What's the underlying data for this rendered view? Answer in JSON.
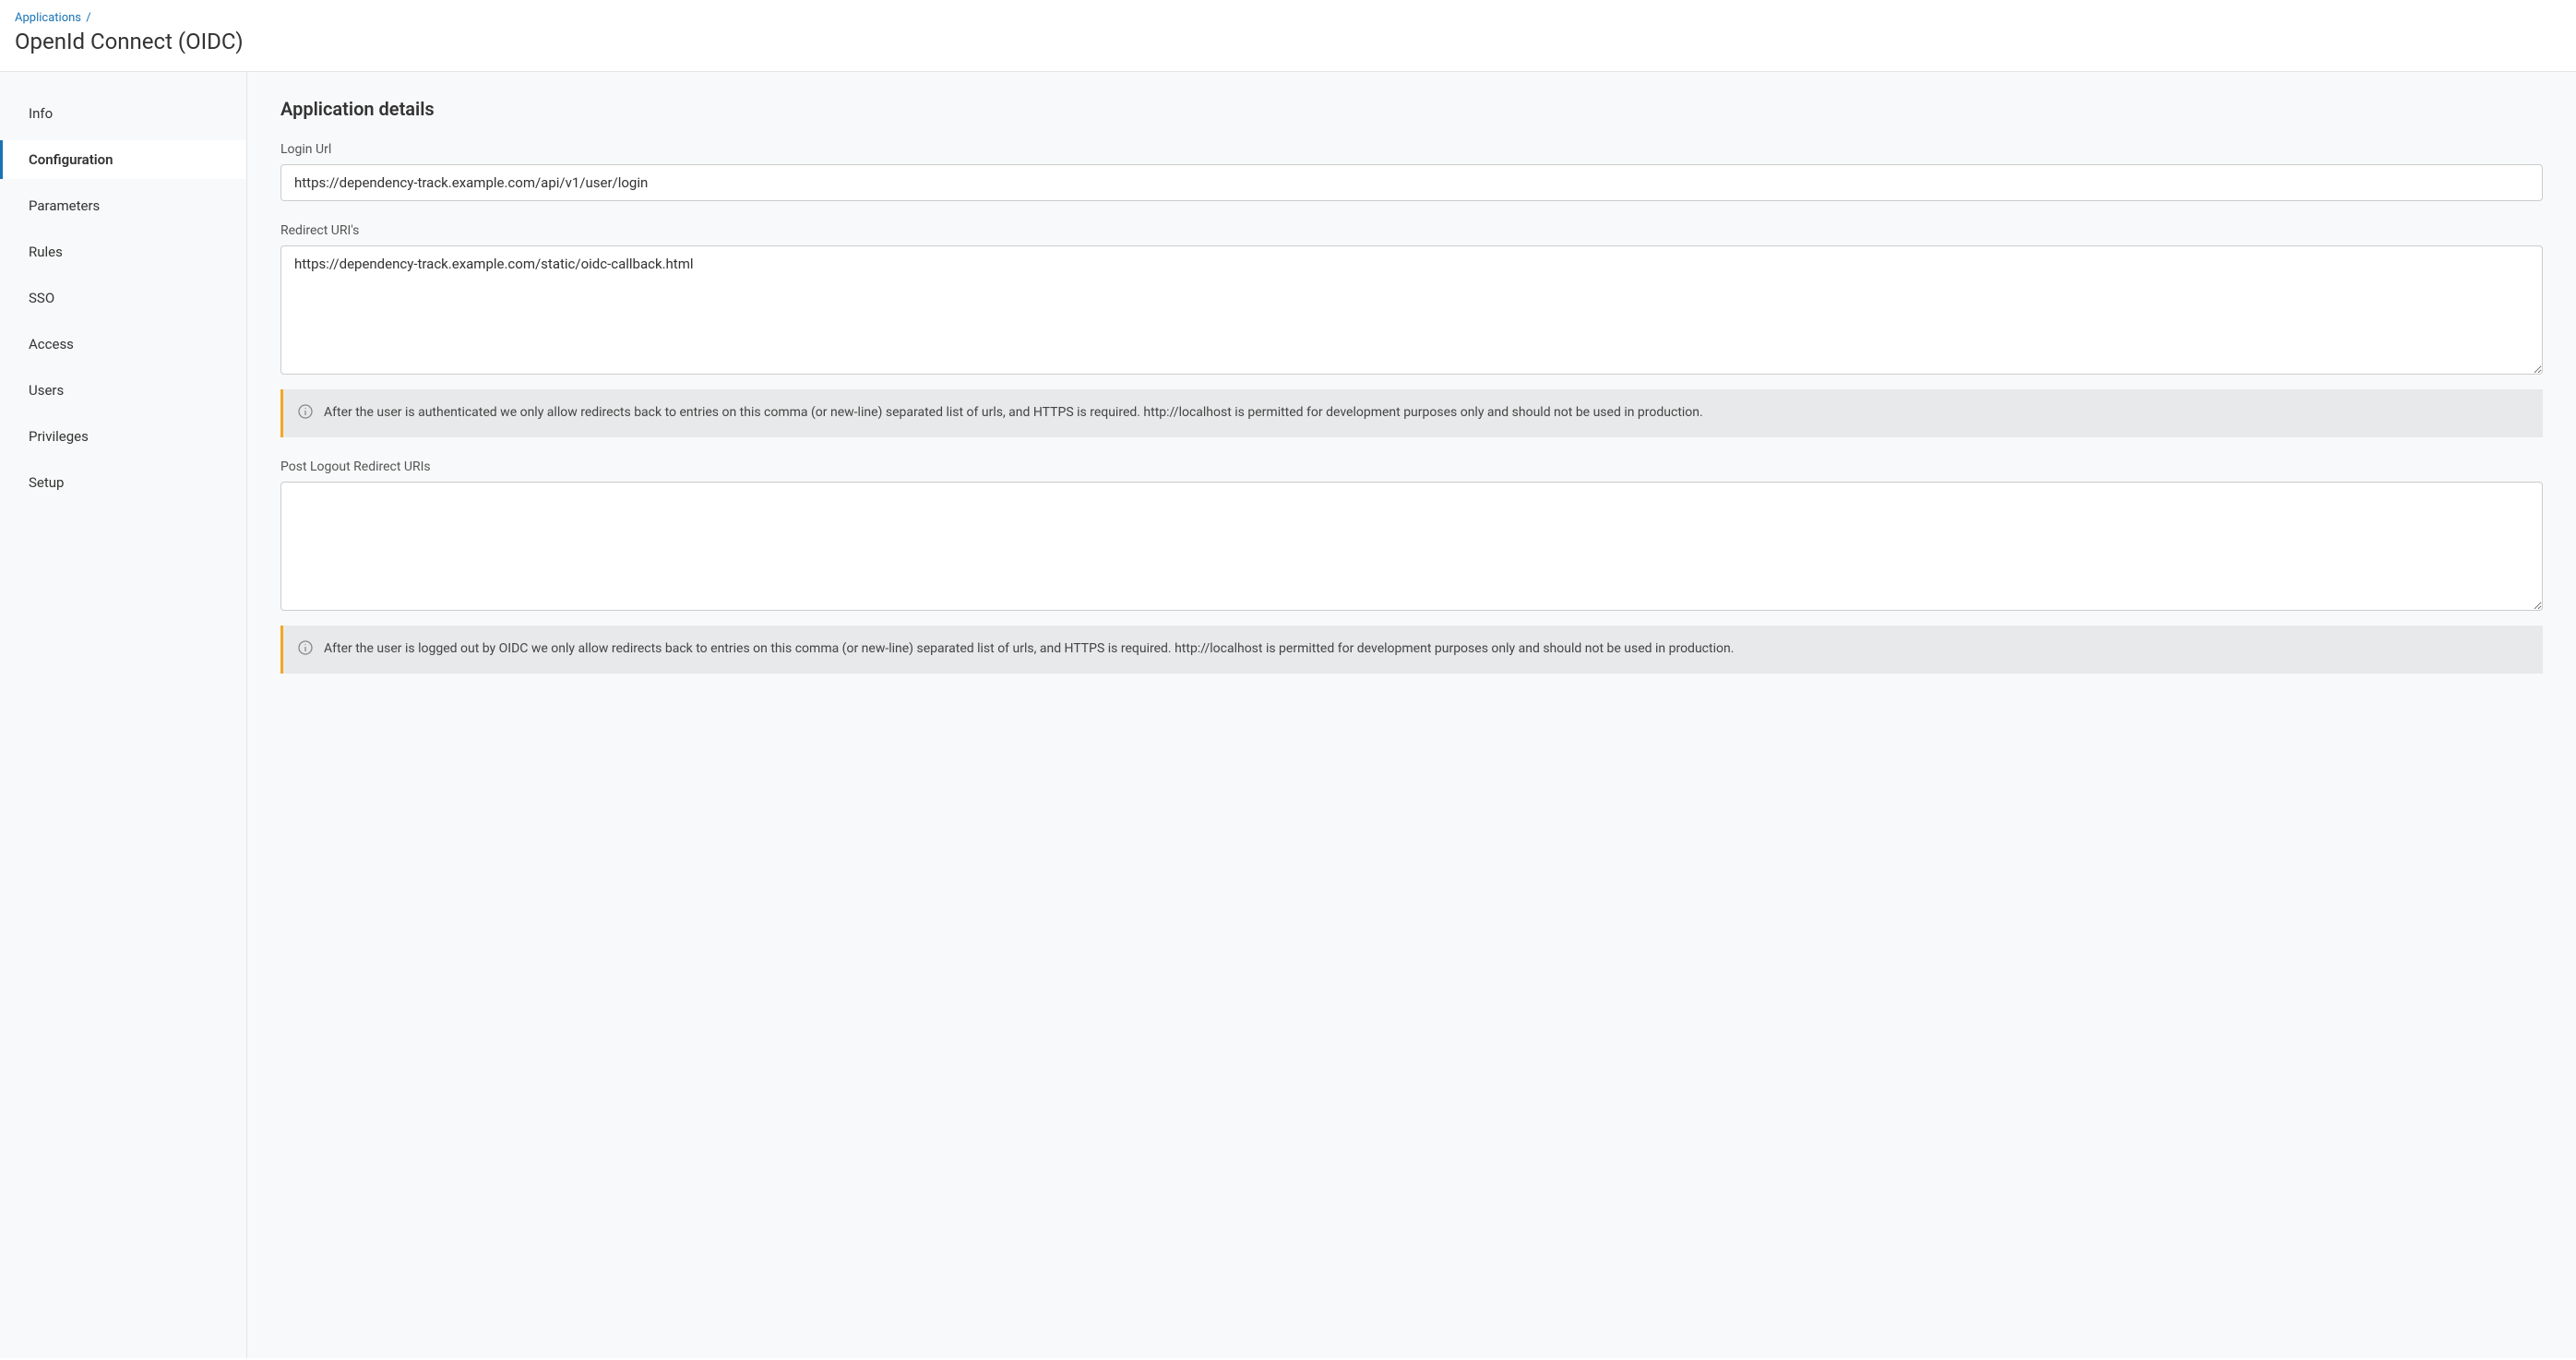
{
  "breadcrumb": {
    "parent": "Applications",
    "separator": "/"
  },
  "page_title": "OpenId Connect (OIDC)",
  "sidebar": {
    "items": [
      {
        "label": "Info",
        "active": false
      },
      {
        "label": "Configuration",
        "active": true
      },
      {
        "label": "Parameters",
        "active": false
      },
      {
        "label": "Rules",
        "active": false
      },
      {
        "label": "SSO",
        "active": false
      },
      {
        "label": "Access",
        "active": false
      },
      {
        "label": "Users",
        "active": false
      },
      {
        "label": "Privileges",
        "active": false
      },
      {
        "label": "Setup",
        "active": false
      }
    ]
  },
  "main": {
    "section_title": "Application details",
    "fields": {
      "login_url": {
        "label": "Login Url",
        "value": "https://dependency-track.example.com/api/v1/user/login"
      },
      "redirect_uris": {
        "label": "Redirect URI's",
        "value": "https://dependency-track.example.com/static/oidc-callback.html",
        "info": "After the user is authenticated we only allow redirects back to entries on this comma (or new-line) separated list of urls, and HTTPS is required. http://localhost is permitted for development purposes only and should not be used in production."
      },
      "post_logout_redirect_uris": {
        "label": "Post Logout Redirect URIs",
        "value": "",
        "info": "After the user is logged out by OIDC we only allow redirects back to entries on this comma (or new-line) separated list of urls, and HTTPS is required. http://localhost is permitted for development purposes only and should not be used in production."
      }
    }
  }
}
